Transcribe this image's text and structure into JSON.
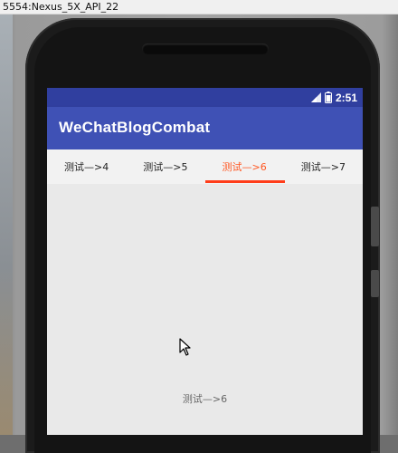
{
  "window": {
    "title": "5554:Nexus_5X_API_22"
  },
  "status_bar": {
    "time": "2:51",
    "icons": [
      "signal-icon",
      "battery-icon"
    ],
    "color": "#303f9f"
  },
  "toolbar": {
    "title": "WeChatBlogCombat",
    "color": "#3f51b5"
  },
  "tabs": [
    {
      "label": "测试—>4",
      "active": false
    },
    {
      "label": "测试—>5",
      "active": false
    },
    {
      "label": "测试—>6",
      "active": true
    },
    {
      "label": "测试—>7",
      "active": false
    }
  ],
  "accent_color": "#ff5722",
  "content": {
    "text": "测试—>6"
  }
}
